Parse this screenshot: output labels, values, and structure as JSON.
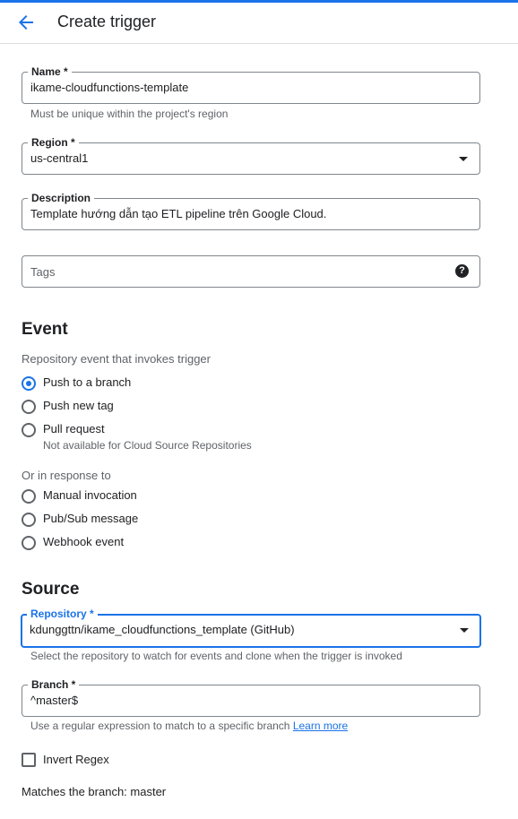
{
  "header": {
    "title": "Create trigger",
    "back_icon": "arrow-back-icon"
  },
  "form": {
    "name": {
      "label": "Name *",
      "value": "ikame-cloudfunctions-template",
      "hint": "Must be unique within the project's region"
    },
    "region": {
      "label": "Region *",
      "value": "us-central1"
    },
    "description": {
      "label": "Description",
      "value": "Template hướng dẫn tạo ETL pipeline trên Google Cloud."
    },
    "tags": {
      "placeholder": "Tags",
      "help_icon": "?"
    }
  },
  "event": {
    "title": "Event",
    "subtitle": "Repository event that invokes trigger",
    "options": [
      {
        "label": "Push to a branch",
        "checked": true
      },
      {
        "label": "Push new tag",
        "checked": false
      },
      {
        "label": "Pull request",
        "checked": false,
        "sub": "Not available for Cloud Source Repositories"
      }
    ],
    "response_label": "Or in response to",
    "response_options": [
      {
        "label": "Manual invocation",
        "checked": false
      },
      {
        "label": "Pub/Sub message",
        "checked": false
      },
      {
        "label": "Webhook event",
        "checked": false
      }
    ]
  },
  "source": {
    "title": "Source",
    "repository": {
      "label": "Repository *",
      "value": "kdunggttn/ikame_cloudfunctions_template (GitHub)",
      "hint": "Select the repository to watch for events and clone when the trigger is invoked"
    },
    "branch": {
      "label": "Branch *",
      "value": "^master$",
      "hint": "Use a regular expression to match to a specific branch",
      "link": "Learn more"
    },
    "invert_regex": {
      "label": "Invert Regex",
      "checked": false
    },
    "matches": "Matches the branch: master"
  },
  "colors": {
    "accent": "#1a73e8",
    "text": "#202124",
    "muted": "#5f6368",
    "border": "#80868b"
  }
}
